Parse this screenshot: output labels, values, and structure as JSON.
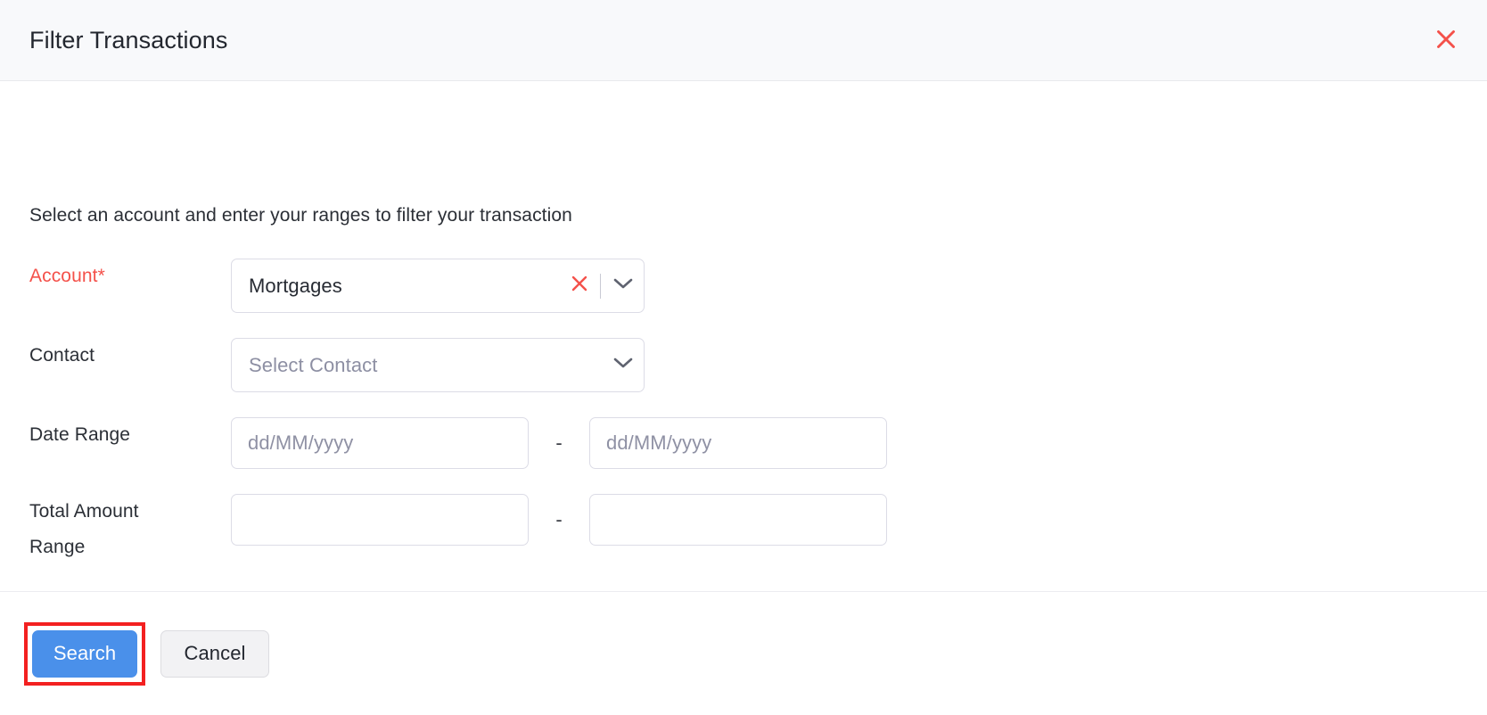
{
  "header": {
    "title": "Filter Transactions",
    "close_icon": "close-icon",
    "close_color": "#f4514a",
    "background": "#f8f9fb"
  },
  "body": {
    "description": "Select an account and enter your ranges to filter your transaction",
    "fields": {
      "account": {
        "label": "Account*",
        "label_color": "#f4514a",
        "required": true,
        "value": "Mortgages",
        "clear_icon": "clear-x-icon",
        "caret_icon": "chevron-down-icon"
      },
      "contact": {
        "label": "Contact",
        "value": "",
        "placeholder": "Select Contact",
        "caret_icon": "chevron-down-icon"
      },
      "date_range": {
        "label": "Date Range",
        "from_value": "",
        "from_placeholder": "dd/MM/yyyy",
        "separator": "-",
        "to_value": "",
        "to_placeholder": "dd/MM/yyyy"
      },
      "total_amount_range": {
        "label_line1": "Total Amount",
        "label_line2": "Range",
        "from_value": "",
        "from_placeholder": "",
        "separator": "-",
        "to_value": "",
        "to_placeholder": ""
      }
    }
  },
  "footer": {
    "search_label": "Search",
    "search_color": "#4a90ea",
    "cancel_label": "Cancel",
    "highlight_color": "#f32020"
  }
}
